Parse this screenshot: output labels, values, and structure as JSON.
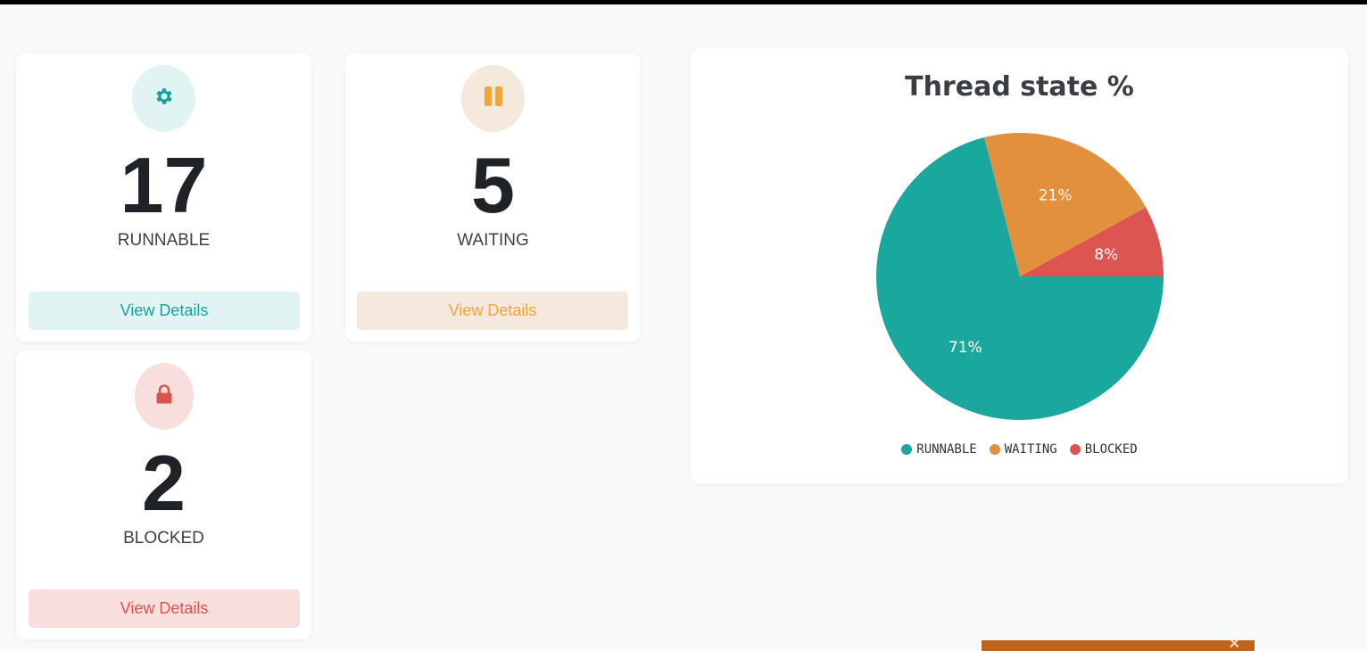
{
  "cards": {
    "runnable": {
      "count": "17",
      "label": "RUNNABLE",
      "button": "View Details",
      "icon": "gear-icon",
      "accent": "#14a39a",
      "tint": "#e2f3f3"
    },
    "waiting": {
      "count": "5",
      "label": "WAITING",
      "button": "View Details",
      "icon": "pause-icon",
      "accent": "#f0a43a",
      "tint": "#f5e8dc"
    },
    "blocked": {
      "count": "2",
      "label": "BLOCKED",
      "button": "View Details",
      "icon": "lock-icon",
      "accent": "#d9534f",
      "tint": "#f9dede"
    }
  },
  "chart_data": {
    "type": "pie",
    "title": "Thread state %",
    "categories": [
      "RUNNABLE",
      "WAITING",
      "BLOCKED"
    ],
    "values": [
      71,
      21,
      8
    ],
    "labels": [
      "71%",
      "21%",
      "8%"
    ],
    "colors": [
      "#1aa79e",
      "#e28f3e",
      "#dc5550"
    ],
    "legend": "bottom"
  },
  "toast": {
    "close": "✕"
  }
}
